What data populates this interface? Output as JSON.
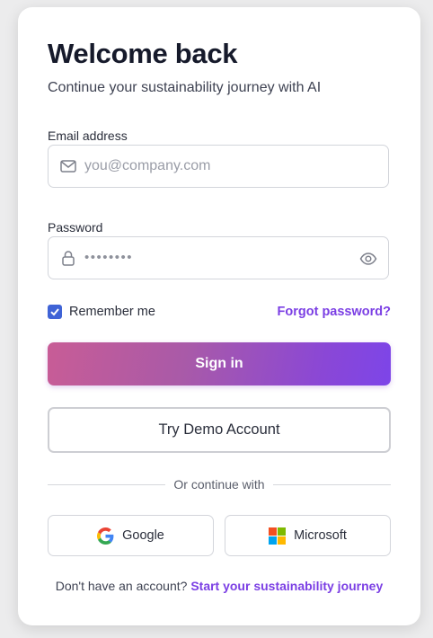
{
  "header": {
    "title": "Welcome back",
    "subtitle": "Continue your sustainability journey with AI"
  },
  "email": {
    "label": "Email address",
    "placeholder": "you@company.com",
    "icon": "mail-icon"
  },
  "password": {
    "label": "Password",
    "masked_value": "••••••••",
    "icon": "lock-icon",
    "toggle_icon": "eye-icon"
  },
  "options": {
    "remember_label": "Remember me",
    "remember_checked": true,
    "forgot_label": "Forgot password?"
  },
  "actions": {
    "signin_label": "Sign in",
    "demo_label": "Try Demo Account"
  },
  "divider": {
    "text": "Or continue with"
  },
  "social": {
    "google_label": "Google",
    "microsoft_label": "Microsoft"
  },
  "footer": {
    "prompt": "Don't have an account?",
    "link": "Start your sustainability journey"
  },
  "colors": {
    "accent": "#7b3fe4",
    "checkbox": "#3f63d6",
    "gradient_start": "#c85c96",
    "gradient_end": "#7d45e8"
  }
}
